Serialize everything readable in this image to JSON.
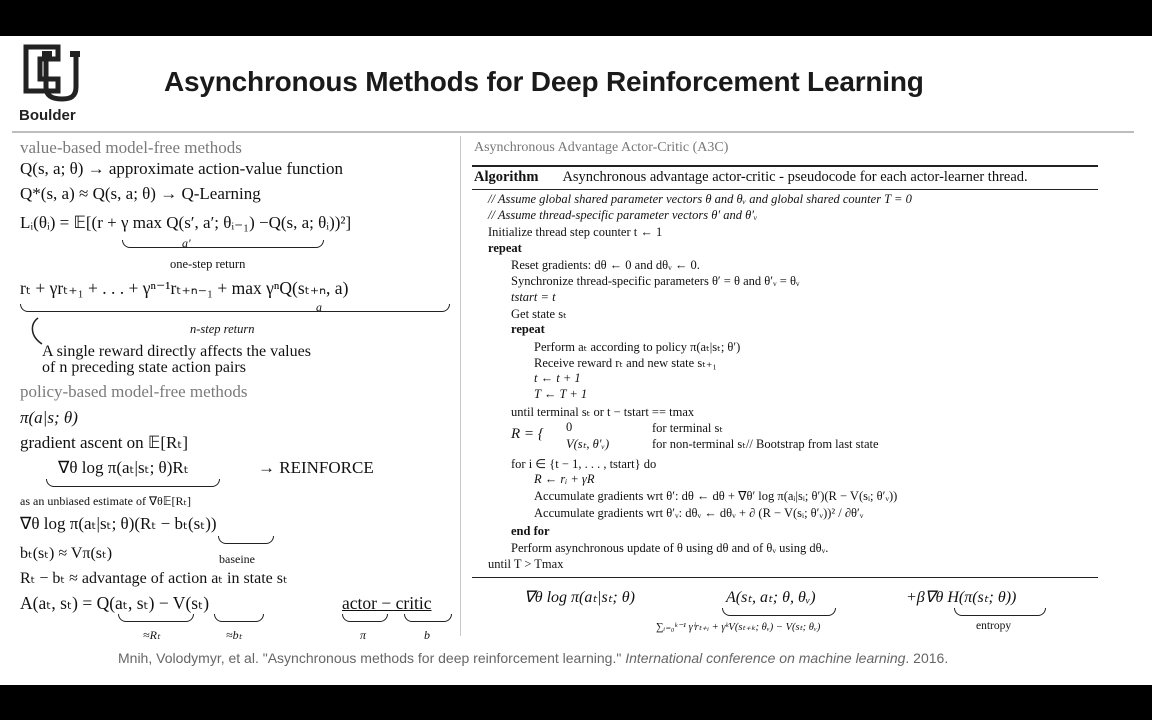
{
  "header": {
    "logo_text": "Boulder",
    "title": "Asynchronous Methods for Deep Reinforcement Learning"
  },
  "left": {
    "value_heading": "value-based model-free methods",
    "q_def": "Q(s, a; θ) → approximate action-value function",
    "q_star": "Q*(s, a) ≈ Q(s, a; θ) → Q-Learning",
    "loss": "Lᵢ(θᵢ) = 𝔼[(r + γ max Q(s′, a′; θᵢ₋₁) −Q(s, a; θᵢ))²]",
    "loss_sub": "a′",
    "one_step_label": "one-step return",
    "nstep": "rₜ + γrₜ₊₁ + . . . + γⁿ⁻¹rₜ₊ₙ₋₁ + max γⁿQ(sₜ₊ₙ, a)",
    "nstep_sub": "a",
    "nstep_label": "n-step return",
    "note_line1": "A single reward directly affects the values",
    "note_line2": "of n preceding state action pairs",
    "policy_heading": "policy-based model-free methods",
    "pi": "π(a|s; θ)",
    "grad_ascent": "gradient ascent on 𝔼[Rₜ]",
    "reinforce_expr": "∇θ log π(aₜ|sₜ; θ)Rₜ",
    "reinforce_arrow": "→ REINFORCE",
    "unbiased": "as an unbiased estimate of ∇θ𝔼[Rₜ]",
    "baseline_expr": "∇θ log π(aₜ|sₜ; θ)(Rₜ − bₜ(sₜ))",
    "baseline_label": "baseine",
    "b_approx": "bₜ(sₜ) ≈ Vπ(sₜ)",
    "advantage_text": "Rₜ − bₜ ≈ advantage of action aₜ in state sₜ",
    "a_def": "A(aₜ, sₜ) = Q(aₜ, sₜ) − V(sₜ)",
    "q_under": "≈Rₜ",
    "v_under": "≈bₜ",
    "actor_critic": "actor − critic",
    "actor_under": "π",
    "critic_under": "b"
  },
  "algorithm": {
    "heading": "Asynchronous Advantage Actor-Critic (A3C)",
    "label": "Algorithm",
    "title": "Asynchronous advantage actor-critic - pseudocode for each actor-learner thread.",
    "lines": [
      "// Assume global shared parameter vectors θ and θᵥ and global shared counter T = 0",
      "// Assume thread-specific parameter vectors θ′ and θ′ᵥ",
      "Initialize thread step counter t ← 1",
      "repeat",
      "Reset gradients: dθ ← 0 and dθᵥ ← 0.",
      "Synchronize thread-specific parameters θ′ = θ and θ′ᵥ = θᵥ",
      "tstart = t",
      "Get state sₜ",
      "repeat",
      "Perform aₜ according to policy π(aₜ|sₜ; θ′)",
      "Receive reward rₜ and new state sₜ₊₁",
      "t ← t + 1",
      "T ← T + 1",
      "until terminal sₜ or t − tstart == tmax",
      "R = {",
      "0",
      "for terminal sₜ",
      "V(sₜ, θ′ᵥ)",
      "for non-terminal sₜ// Bootstrap from last state",
      "for i ∈ {t − 1, . . . , tstart} do",
      "R ← rᵢ + γR",
      "Accumulate gradients wrt θ′: dθ ← dθ + ∇θ′ log π(aᵢ|sᵢ; θ′)(R − V(sᵢ; θ′ᵥ))",
      "Accumulate gradients wrt θ′ᵥ: dθᵥ ← dθᵥ + ∂ (R − V(sᵢ; θ′ᵥ))² / ∂θ′ᵥ",
      "end for",
      "Perform asynchronous update of θ using dθ and of θᵥ using dθᵥ.",
      "until T > Tmax"
    ]
  },
  "bottom_formula": {
    "grad": "∇θ log π(aₜ|sₜ; θ)",
    "adv": "A(sₜ, aₜ; θ, θᵥ)",
    "adv_under": "∑ᵢ₌₀ᵏ⁻¹ γⁱrₜ₊ᵢ + γᵏV(sₜ₊ₖ; θᵥ) − V(sₜ; θᵥ)",
    "entropy_term": "+β∇θ H(π(sₜ; θ))",
    "entropy_label": "entropy"
  },
  "citation": {
    "text": "Mnih, Volodymyr, et al. \"Asynchronous methods for deep reinforcement learning.\"",
    "venue": "International conference on machine learning",
    "year": ". 2016."
  },
  "colors": {
    "background": "#ffffff",
    "letterbox": "#000000",
    "heading_gray": "#7a7a7a"
  }
}
